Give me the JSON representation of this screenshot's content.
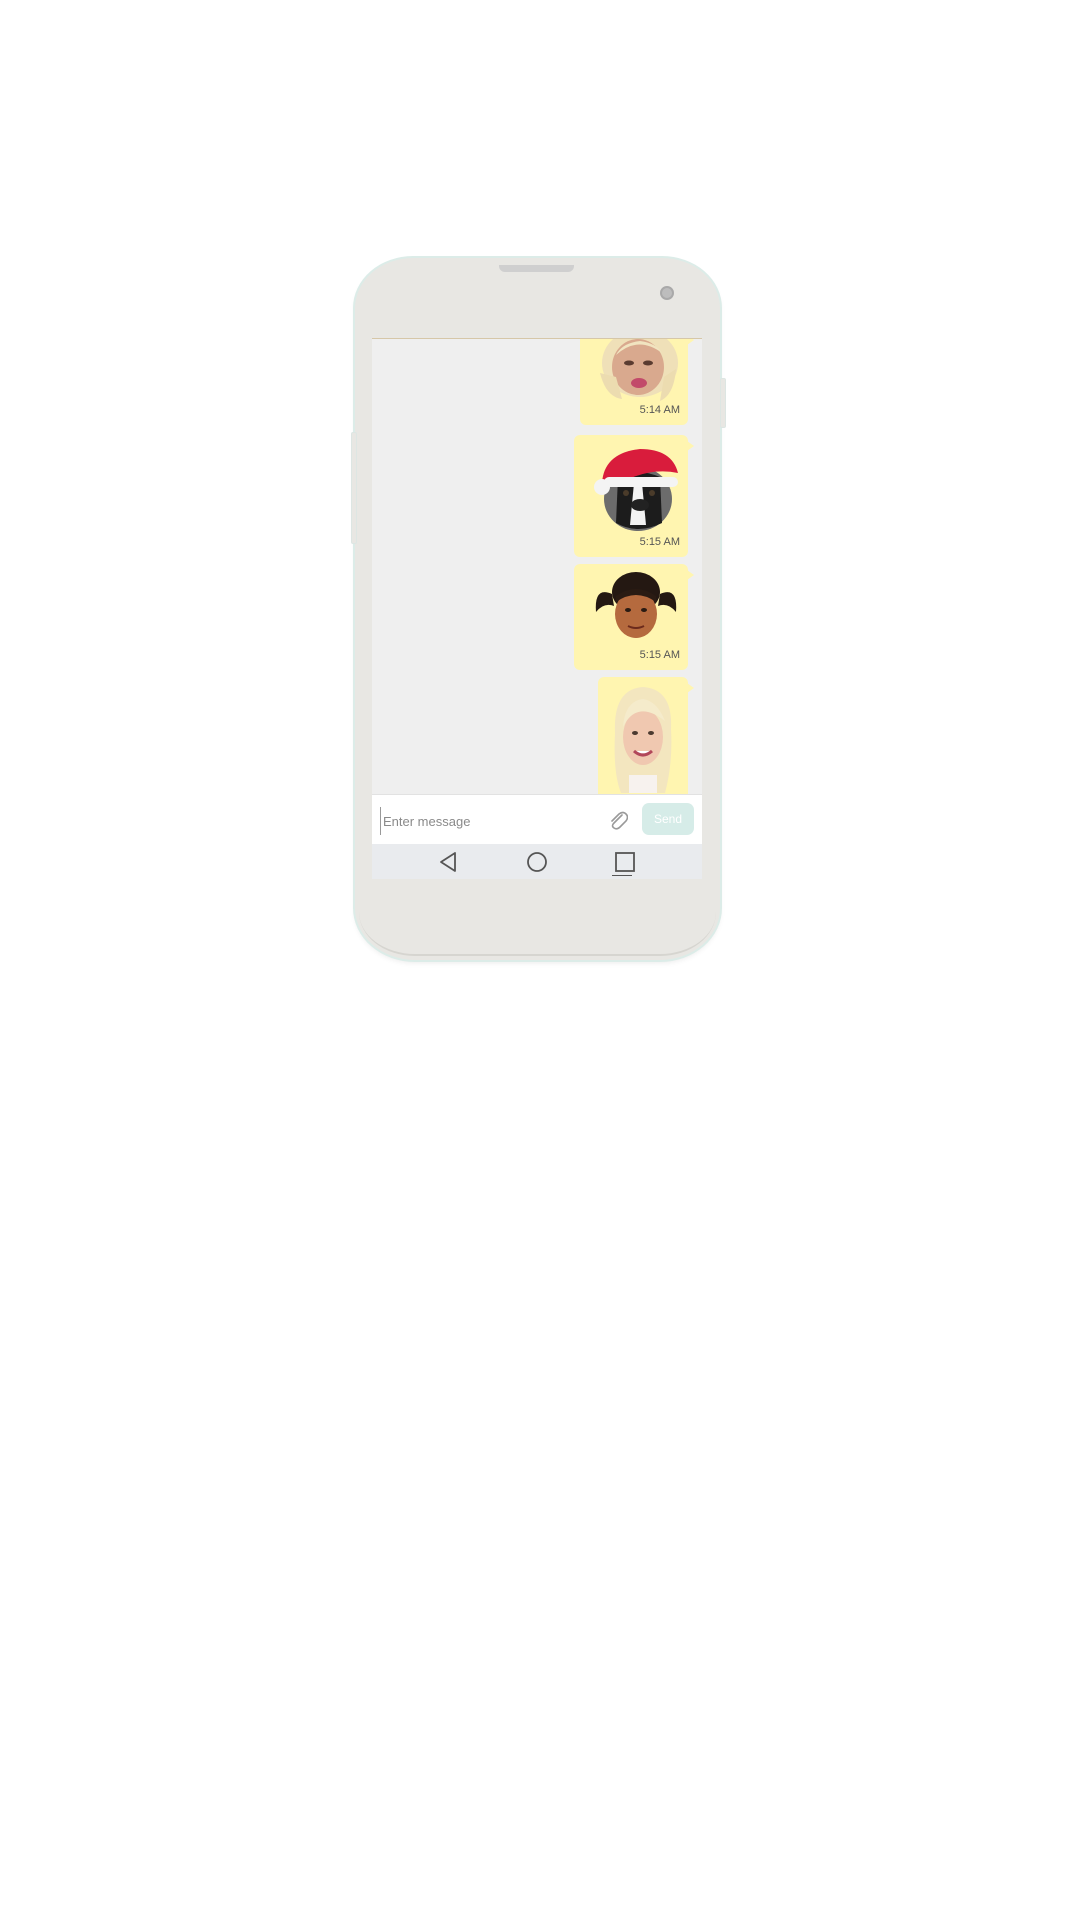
{
  "messages": [
    {
      "sticker": "blonde-woman-pout-sticker",
      "time": "5:14 AM"
    },
    {
      "sticker": "dog-santa-hat-sticker",
      "time": "5:15 AM"
    },
    {
      "sticker": "woman-pigtails-sticker",
      "time": "5:15 AM"
    },
    {
      "sticker": "blonde-woman-smile-sticker",
      "time": ""
    }
  ],
  "composer": {
    "placeholder": "Enter message",
    "attach_icon": "paperclip-icon",
    "send_label": "Send"
  },
  "navbar": {
    "back_icon": "back-triangle-icon",
    "home_icon": "home-circle-icon",
    "recents_icon": "recents-square-icon"
  },
  "colors": {
    "bubble": "#fff5b0",
    "chat_background": "#efefef",
    "send_button": "#d6ece8",
    "navbar": "#e9ebee"
  }
}
